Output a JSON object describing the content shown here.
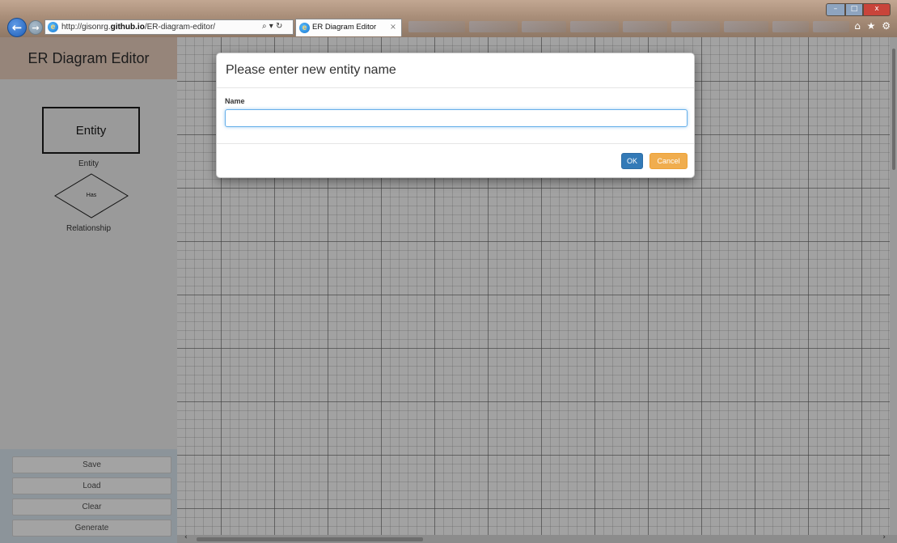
{
  "browser": {
    "url_prefix": "http://gisonrg.",
    "url_domain": "github.io",
    "url_path": "/ER-diagram-editor/",
    "address_tools": "⌕ ▾ ↻",
    "tab_title": "ER Diagram Editor",
    "tab_close": "×",
    "window_min": "–",
    "window_max": "□",
    "window_close": "x",
    "toolbar_icons": "⌂ ★ ⚙"
  },
  "sidebar": {
    "title": "ER Diagram Editor",
    "palette": {
      "entity_label": "Entity",
      "entity_caption": "Entity",
      "relationship_label": "Has",
      "relationship_caption": "Relationship"
    },
    "buttons": {
      "save": "Save",
      "load": "Load",
      "clear": "Clear",
      "generate": "Generate"
    }
  },
  "modal": {
    "title": "Please enter new entity name",
    "field_label": "Name",
    "field_value": "",
    "field_placeholder": "",
    "ok_label": "OK",
    "cancel_label": "Cancel"
  },
  "scrollbar": {
    "left_arrow": "‹",
    "right_arrow": "›"
  },
  "colors": {
    "primary": "#337ab7",
    "warning": "#f0ad4e",
    "focus": "#66afe9"
  }
}
